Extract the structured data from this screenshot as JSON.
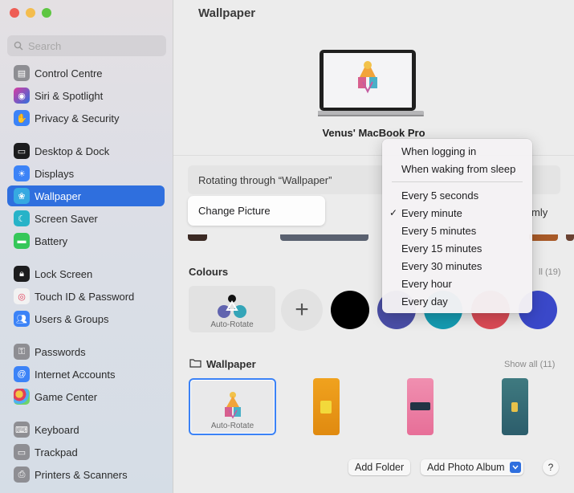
{
  "window": {
    "traffic_colors": [
      "#ee5d55",
      "#f4bd4e",
      "#5ec642"
    ]
  },
  "sidebar": {
    "search_placeholder": "Search",
    "items": [
      {
        "label": "Control Centre",
        "icon": "control-centre-icon",
        "color": "#8e8e93",
        "active": false
      },
      {
        "label": "Siri & Spotlight",
        "icon": "siri-icon",
        "color": "#a34fd6",
        "active": false
      },
      {
        "label": "Privacy & Security",
        "icon": "hand-icon",
        "color": "#3c83f7",
        "active": false
      },
      {
        "label": "Desktop & Dock",
        "icon": "dock-icon",
        "color": "#1c1c1e",
        "active": false
      },
      {
        "label": "Displays",
        "icon": "sun-icon",
        "color": "#3c83f7",
        "active": false
      },
      {
        "label": "Wallpaper",
        "icon": "flower-icon",
        "color": "#36a9e1",
        "active": true
      },
      {
        "label": "Screen Saver",
        "icon": "moon-icon",
        "color": "#27b3c8",
        "active": false
      },
      {
        "label": "Battery",
        "icon": "battery-icon",
        "color": "#35c759",
        "active": false
      },
      {
        "label": "Lock Screen",
        "icon": "lock-icon",
        "color": "#1c1c1e",
        "active": false
      },
      {
        "label": "Touch ID & Password",
        "icon": "fingerprint-icon",
        "color": "#f2f2f2",
        "active": false
      },
      {
        "label": "Users & Groups",
        "icon": "users-icon",
        "color": "#3c83f7",
        "active": false
      },
      {
        "label": "Passwords",
        "icon": "key-icon",
        "color": "#8e8e93",
        "active": false
      },
      {
        "label": "Internet Accounts",
        "icon": "at-icon",
        "color": "#3c83f7",
        "active": false
      },
      {
        "label": "Game Center",
        "icon": "game-center-icon",
        "color": "#ffffff",
        "active": false
      },
      {
        "label": "Keyboard",
        "icon": "keyboard-icon",
        "color": "#8e8e93",
        "active": false
      },
      {
        "label": "Trackpad",
        "icon": "trackpad-icon",
        "color": "#8e8e93",
        "active": false
      },
      {
        "label": "Printers & Scanners",
        "icon": "printer-icon",
        "color": "#8e8e93",
        "active": false
      }
    ]
  },
  "main": {
    "title": "Wallpaper",
    "device_name": "Venus' MacBook Pro",
    "rotating_label": "Rotating through “Wallpaper”",
    "change_picture_label": "Change Picture",
    "partial_label": "mly",
    "colours": {
      "heading": "Colours",
      "show_all": "ll (19)",
      "auto_rotate_label": "Auto-Rotate",
      "swatches": [
        "#000000",
        "#4a4ea6",
        "#159ab0",
        "#d94a55",
        "#3a48c9"
      ]
    },
    "wallpaper": {
      "heading": "Wallpaper",
      "show_all": "Show all (11)",
      "auto_rotate_label": "Auto-Rotate"
    },
    "add_folder_label": "Add Folder",
    "add_album_label": "Add Photo Album",
    "help_label": "?"
  },
  "menu": {
    "items_top": [
      "When logging in",
      "When waking from sleep"
    ],
    "items_bottom": [
      {
        "label": "Every 5 seconds",
        "checked": false
      },
      {
        "label": "Every minute",
        "checked": true
      },
      {
        "label": "Every 5 minutes",
        "checked": false
      },
      {
        "label": "Every 15 minutes",
        "checked": false
      },
      {
        "label": "Every 30 minutes",
        "checked": false
      },
      {
        "label": "Every hour",
        "checked": false
      },
      {
        "label": "Every day",
        "checked": false
      }
    ],
    "check_glyph": "✓"
  }
}
